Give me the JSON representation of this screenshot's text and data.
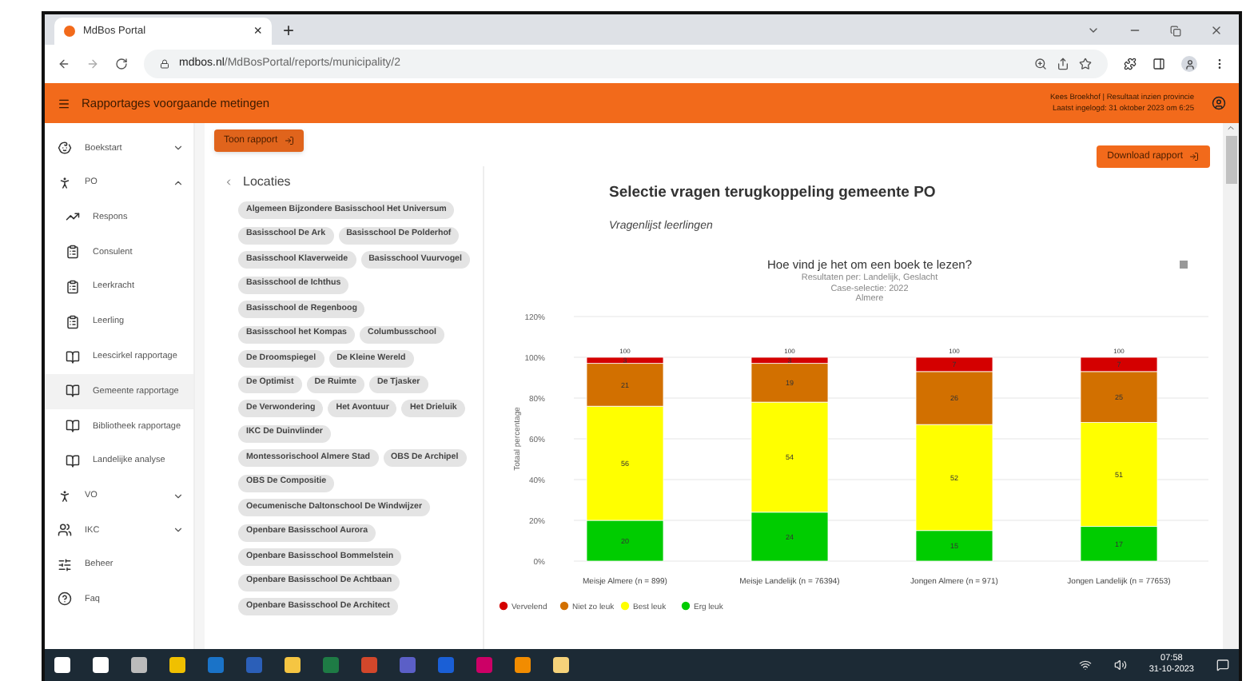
{
  "browser": {
    "tab_title": "MdBos Portal",
    "tab_close": "×",
    "new_tab": "+",
    "url_host": "mdbos.nl",
    "url_path": "/MdBosPortal/reports/municipality/2"
  },
  "header": {
    "title": "Rapportages voorgaande metingen",
    "user": "Kees Broekhof | Resultaat inzien provincie",
    "last_login": "Laatst ingelogd: 31 oktober 2023 om 6:25"
  },
  "sidebar": {
    "items": [
      {
        "label": "Boekstart",
        "expanded": false,
        "selected": false
      },
      {
        "label": "PO",
        "expanded": true,
        "selected": false,
        "children": [
          {
            "label": "Respons",
            "selected": false
          },
          {
            "label": "Consulent",
            "selected": false
          },
          {
            "label": "Leerkracht",
            "selected": false
          },
          {
            "label": "Leerling",
            "selected": false
          },
          {
            "label": "Leescirkel rapportage",
            "selected": false
          },
          {
            "label": "Gemeente rapportage",
            "selected": true
          },
          {
            "label": "Bibliotheek rapportage",
            "selected": false
          },
          {
            "label": "Landelijke analyse",
            "selected": false
          }
        ]
      },
      {
        "label": "VO",
        "expanded": false,
        "selected": false
      },
      {
        "label": "IKC",
        "expanded": false,
        "selected": false
      },
      {
        "label": "Beheer",
        "selected": false
      },
      {
        "label": "Faq",
        "selected": false
      }
    ]
  },
  "toolbar": {
    "show_button": "Toon rapport",
    "download_button": "Download rapport"
  },
  "locations": {
    "title": "Locaties",
    "chips": [
      "Algemeen Bijzondere Basisschool Het Universum",
      "Basisschool De Ark",
      "Basisschool De Polderhof",
      "Basisschool Klaverweide",
      "Basisschool Vuurvogel",
      "Basisschool de Ichthus",
      "Basisschool de Regenboog",
      "Basisschool het Kompas",
      "Columbusschool",
      "De Droomspiegel",
      "De Kleine Wereld",
      "De Optimist",
      "De Ruimte",
      "De Tjasker",
      "De Verwondering",
      "Het Avontuur",
      "Het Drieluik",
      "IKC De Duinvlinder",
      "Montessorischool Almere Stad",
      "OBS De Archipel",
      "OBS De Compositie",
      "Oecumenische Daltonschool De Windwijzer",
      "Openbare Basisschool Aurora",
      "Openbare Basisschool Bommelstein",
      "Openbare Basisschool De Achtbaan",
      "Openbare Basisschool De Architect"
    ]
  },
  "report": {
    "title": "Selectie vragen terugkoppeling gemeente PO",
    "subtitle": "Vragenlijst leerlingen",
    "chart": {
      "subtitle_lines": [
        "Resultaten per: Landelijk, Geslacht",
        "Case-selectie: 2022",
        "Almere"
      ],
      "total_labels": [
        "100",
        "100",
        "100",
        "100"
      ],
      "chart_data": {
        "type": "bar",
        "stacked": true,
        "title": "Hoe vind je het om een boek te lezen?",
        "ylabel": "Totaal percentage",
        "categories": [
          "Meisje Almere (n = 899)",
          "Meisje Landelijk (n = 76394)",
          "Jongen Almere (n = 971)",
          "Jongen Landelijk (n = 77653)"
        ],
        "series": [
          {
            "name": "Vervelend",
            "color": "#d40000",
            "values": [
              3,
              3,
              7,
              7
            ]
          },
          {
            "name": "Niet zo leuk",
            "color": "#d27000",
            "values": [
              21,
              19,
              26,
              25
            ]
          },
          {
            "name": "Best leuk",
            "color": "#ffff00",
            "values": [
              56,
              54,
              52,
              51
            ]
          },
          {
            "name": "Erg leuk",
            "color": "#00cc00",
            "values": [
              20,
              24,
              15,
              17
            ]
          }
        ],
        "ylim": [
          0,
          120
        ],
        "yticks": [
          {
            "value": 0,
            "label": "0%"
          },
          {
            "value": 20,
            "label": "20%"
          },
          {
            "value": 40,
            "label": "40%"
          },
          {
            "value": 60,
            "label": "60%"
          },
          {
            "value": 80,
            "label": "80%"
          },
          {
            "value": 100,
            "label": "100%"
          },
          {
            "value": 120,
            "label": "120%"
          }
        ],
        "data_labels": true,
        "grid": true,
        "legend": true
      }
    }
  },
  "taskbar": {
    "time": "07:58",
    "date": "31-10-2023"
  }
}
